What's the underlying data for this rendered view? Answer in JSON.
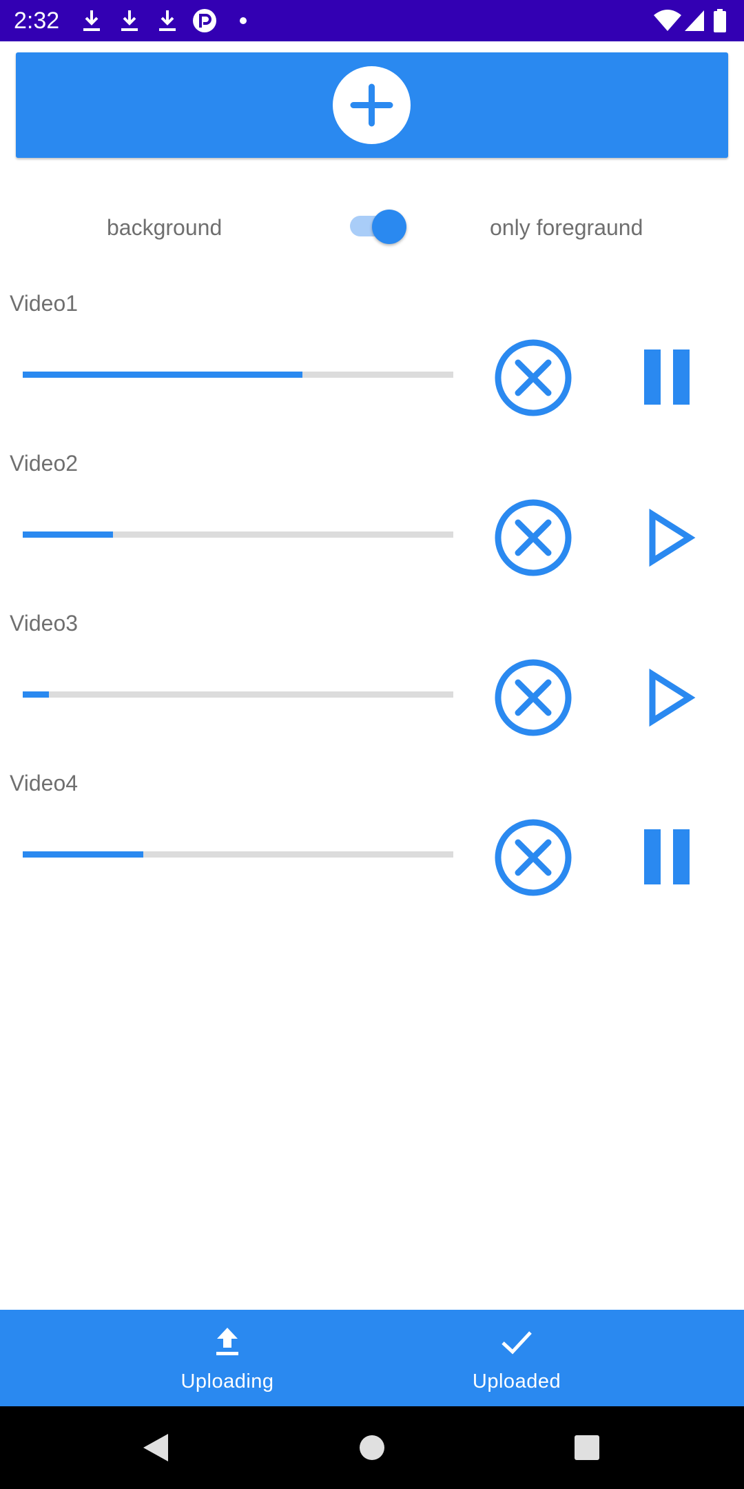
{
  "status_bar": {
    "time": "2:32",
    "left_icons": [
      "download-icon",
      "download-icon",
      "download-icon",
      "app-notification-icon",
      "dot-icon"
    ],
    "right_icons": [
      "wifi-icon",
      "cell-signal-icon",
      "battery-icon"
    ],
    "background_color": "#3300b3"
  },
  "add_button": {
    "icon": "plus-circle-icon",
    "color": "#2a89f0"
  },
  "mode_toggle": {
    "left_label": "background",
    "right_label": "only foregraund",
    "checked": true
  },
  "videos": [
    {
      "title": "Video1",
      "progress": 0.65,
      "cancel_icon": "cancel-circle-icon",
      "action_icon": "pause-icon"
    },
    {
      "title": "Video2",
      "progress": 0.21,
      "cancel_icon": "cancel-circle-icon",
      "action_icon": "play-icon"
    },
    {
      "title": "Video3",
      "progress": 0.06,
      "cancel_icon": "cancel-circle-icon",
      "action_icon": "play-icon"
    },
    {
      "title": "Video4",
      "progress": 0.28,
      "cancel_icon": "cancel-circle-icon",
      "action_icon": "pause-icon"
    }
  ],
  "bottom_nav": {
    "items": [
      {
        "label": "Uploading",
        "icon": "upload-icon"
      },
      {
        "label": "Uploaded",
        "icon": "check-icon"
      }
    ]
  },
  "system_nav": {
    "buttons": [
      "back-icon",
      "home-icon",
      "recents-icon"
    ]
  },
  "colors": {
    "accent": "#2a89f0",
    "track": "#dcdcdc",
    "text": "#6f6f6f"
  }
}
